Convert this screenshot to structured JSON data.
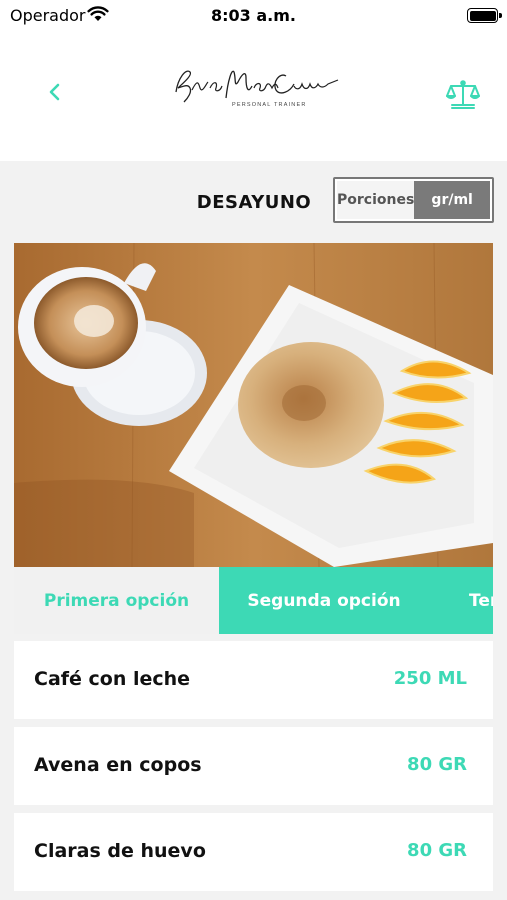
{
  "status_bar": {
    "carrier": "Operador",
    "time": "8:03 a.m."
  },
  "header": {
    "logo_script": "Eva Maria Cueva",
    "logo_tagline": "PERSONAL TRAINER"
  },
  "meal": {
    "title": "DESAYUNO",
    "units_toggle": {
      "options": [
        "Porciones",
        "gr/ml"
      ],
      "selected": "gr/ml"
    }
  },
  "options_tabs": {
    "items": [
      {
        "label": "Primera opción",
        "active": false
      },
      {
        "label": "Segunda opción",
        "active": true
      },
      {
        "label": "Tercera opción",
        "active": false
      }
    ]
  },
  "ingredients": [
    {
      "name": "Café con leche",
      "quantity": "250 ML"
    },
    {
      "name": "Avena en copos",
      "quantity": "80 GR"
    },
    {
      "name": "Claras de huevo",
      "quantity": "80 GR"
    }
  ],
  "colors": {
    "accent": "#3dd9b5",
    "background": "#f2f2f2",
    "toggle_selected": "#7a7a7a"
  },
  "icons": {
    "back": "chevron-left-icon",
    "scale": "balance-scale-icon",
    "wifi": "wifi-icon",
    "battery": "battery-icon"
  }
}
